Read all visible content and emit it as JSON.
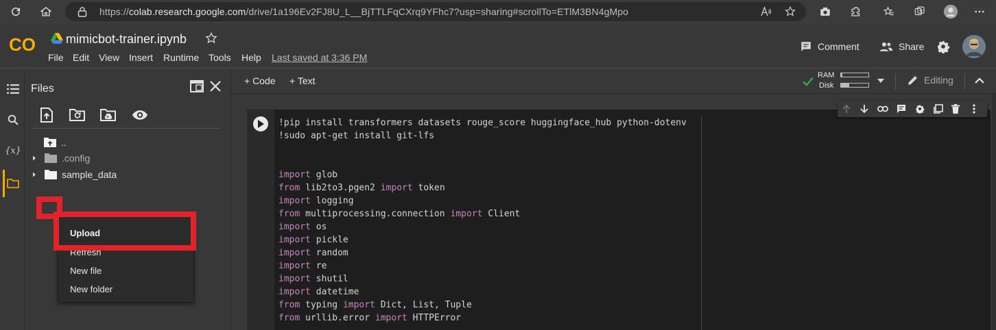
{
  "browser": {
    "url_prefix": "https://",
    "url_host": "colab.research.google.com",
    "url_path": "/drive/1a196Ev2FJ8U_L__BjTTLFqCXrq9YFhc7?usp=sharing#scrollTo=ETlM3BN4gMpo"
  },
  "header": {
    "logo_text": "CO",
    "title": "mimicbot-trainer.ipynb",
    "menu": [
      "File",
      "Edit",
      "View",
      "Insert",
      "Runtime",
      "Tools",
      "Help"
    ],
    "last_saved": "Last saved at 3:36 PM",
    "comment_label": "Comment",
    "share_label": "Share"
  },
  "files_panel": {
    "title": "Files",
    "tree": [
      {
        "label": ".."
      },
      {
        "label": ".config"
      },
      {
        "label": "sample_data"
      }
    ]
  },
  "context_menu": {
    "items": [
      "Upload",
      "Refresh",
      "New file",
      "New folder"
    ]
  },
  "toolbar": {
    "code_label": "+ Code",
    "text_label": "+ Text",
    "ram_label": "RAM",
    "disk_label": "Disk",
    "ram_usage": 0.05,
    "disk_usage": 0.3,
    "editing_label": "Editing",
    "rail_variables_icon": "{x}"
  },
  "cell": {
    "lines": [
      [
        {
          "t": "!pip install transformers datasets rouge_score huggingface_hub python-dotenv"
        }
      ],
      [
        {
          "t": "!sudo apt-get install git-lfs"
        }
      ],
      [
        {
          "t": ""
        }
      ],
      [
        {
          "t": ""
        }
      ],
      [
        {
          "t": "import",
          "k": 1
        },
        {
          "t": " glob"
        }
      ],
      [
        {
          "t": "from",
          "k": 1
        },
        {
          "t": " lib2to3.pgen2 "
        },
        {
          "t": "import",
          "k": 1
        },
        {
          "t": " token"
        }
      ],
      [
        {
          "t": "import",
          "k": 1
        },
        {
          "t": " logging"
        }
      ],
      [
        {
          "t": "from",
          "k": 1
        },
        {
          "t": " multiprocessing.connection "
        },
        {
          "t": "import",
          "k": 1
        },
        {
          "t": " Client"
        }
      ],
      [
        {
          "t": "import",
          "k": 1
        },
        {
          "t": " os"
        }
      ],
      [
        {
          "t": "import",
          "k": 1
        },
        {
          "t": " pickle"
        }
      ],
      [
        {
          "t": "import",
          "k": 1
        },
        {
          "t": " random"
        }
      ],
      [
        {
          "t": "import",
          "k": 1
        },
        {
          "t": " re"
        }
      ],
      [
        {
          "t": "import",
          "k": 1
        },
        {
          "t": " shutil"
        }
      ],
      [
        {
          "t": "import",
          "k": 1
        },
        {
          "t": " datetime"
        }
      ],
      [
        {
          "t": "from",
          "k": 1
        },
        {
          "t": " typing "
        },
        {
          "t": "import",
          "k": 1
        },
        {
          "t": " Dict, List, Tuple"
        }
      ],
      [
        {
          "t": "from",
          "k": 1
        },
        {
          "t": " urllib.error "
        },
        {
          "t": "import",
          "k": 1
        },
        {
          "t": " HTTPError"
        }
      ]
    ]
  },
  "colors": {
    "accent_orange": "#f9ab00",
    "highlight_red": "#e3232a",
    "keyword": "#c586c0",
    "check_green": "#34a853"
  }
}
